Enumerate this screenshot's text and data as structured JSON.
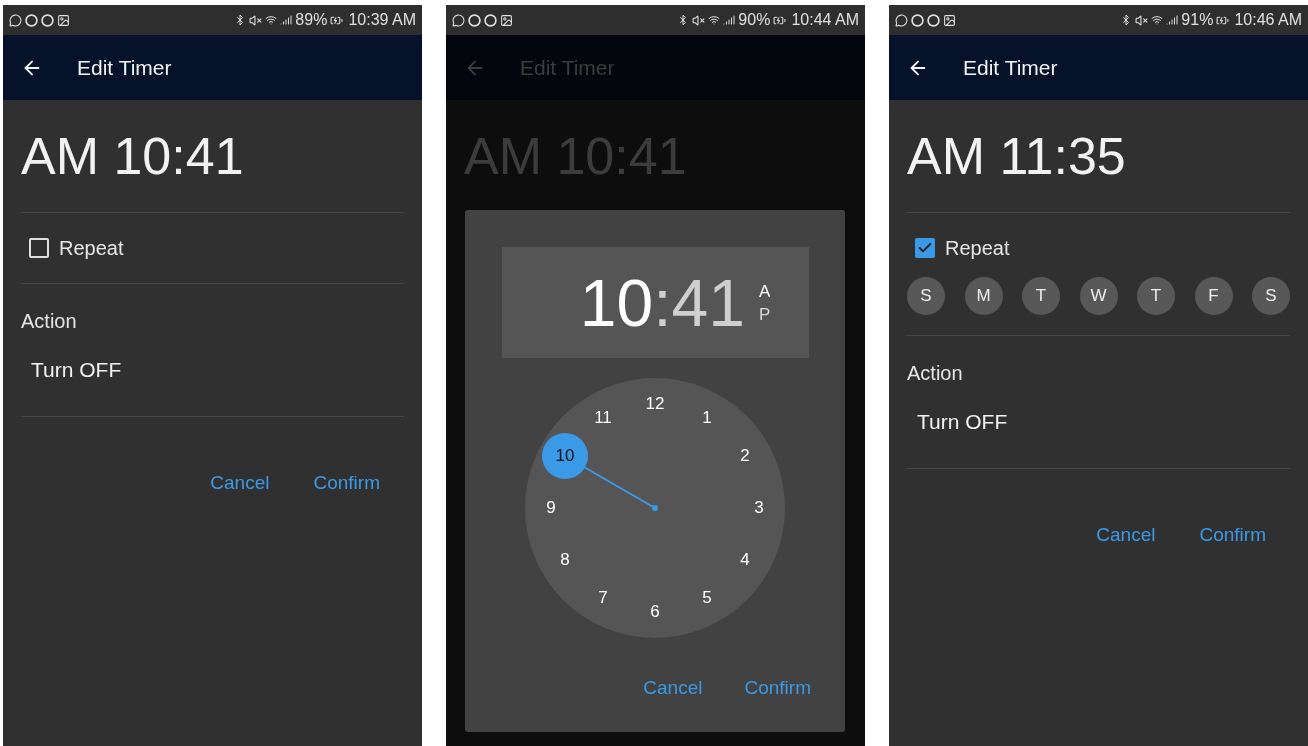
{
  "screens": [
    {
      "status_bar": {
        "battery": "89%",
        "time": "10:39 AM"
      },
      "app_bar": {
        "title": "Edit Timer"
      },
      "dimmed": false,
      "time_display": "AM 10:41",
      "repeat": {
        "label": "Repeat",
        "checked": false
      },
      "action": {
        "label": "Action",
        "value": "Turn OFF"
      },
      "buttons": [
        "Cancel",
        "Confirm"
      ]
    },
    {
      "status_bar": {
        "battery": "90%",
        "time": "10:44 AM"
      },
      "app_bar": {
        "title": "Edit Timer"
      },
      "dimmed": true,
      "time_display": "AM 10:41",
      "dialog": {
        "hour": {
          "text": "10",
          "selected": true
        },
        "separator": ":",
        "minute": {
          "text": "41",
          "selected": false
        },
        "periods": [
          {
            "label": "A",
            "selected": true
          },
          {
            "label": "P",
            "selected": false
          }
        ],
        "numbers": [
          {
            "label": "12",
            "selected": false
          },
          {
            "label": "1",
            "selected": false
          },
          {
            "label": "2",
            "selected": false
          },
          {
            "label": "3",
            "selected": false
          },
          {
            "label": "4",
            "selected": false
          },
          {
            "label": "5",
            "selected": false
          },
          {
            "label": "6",
            "selected": false
          },
          {
            "label": "7",
            "selected": false
          },
          {
            "label": "8",
            "selected": false
          },
          {
            "label": "9",
            "selected": false
          },
          {
            "label": "10",
            "selected": true
          },
          {
            "label": "11",
            "selected": false
          }
        ],
        "buttons": [
          "Cancel",
          "Confirm"
        ]
      }
    },
    {
      "status_bar": {
        "battery": "91%",
        "time": "10:46 AM"
      },
      "app_bar": {
        "title": "Edit Timer"
      },
      "dimmed": false,
      "time_display": "AM 11:35",
      "repeat": {
        "label": "Repeat",
        "checked": true
      },
      "days": [
        {
          "label": "S",
          "selected": false
        },
        {
          "label": "M",
          "selected": false
        },
        {
          "label": "T",
          "selected": false
        },
        {
          "label": "W",
          "selected": false
        },
        {
          "label": "T",
          "selected": false
        },
        {
          "label": "F",
          "selected": false
        },
        {
          "label": "S",
          "selected": false
        }
      ],
      "action": {
        "label": "Action",
        "value": "Turn OFF"
      },
      "buttons": [
        "Cancel",
        "Confirm"
      ]
    }
  ]
}
